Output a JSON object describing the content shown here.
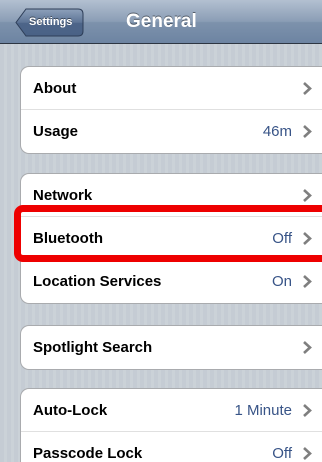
{
  "navbar": {
    "back_label": "Settings",
    "title": "General"
  },
  "groups": [
    {
      "rows": [
        {
          "label": "About",
          "value": ""
        },
        {
          "label": "Usage",
          "value": "46m"
        }
      ]
    },
    {
      "rows": [
        {
          "label": "Network",
          "value": ""
        },
        {
          "label": "Bluetooth",
          "value": "Off"
        },
        {
          "label": "Location Services",
          "value": "On"
        }
      ]
    },
    {
      "rows": [
        {
          "label": "Spotlight Search",
          "value": ""
        }
      ]
    },
    {
      "rows": [
        {
          "label": "Auto-Lock",
          "value": "1 Minute"
        },
        {
          "label": "Passcode Lock",
          "value": "Off"
        }
      ]
    }
  ],
  "colors": {
    "value_text": "#385487",
    "highlight": "#ee0000",
    "navbar": "#6d84a2"
  },
  "icons": {
    "disclosure": "chevron-right-icon"
  }
}
